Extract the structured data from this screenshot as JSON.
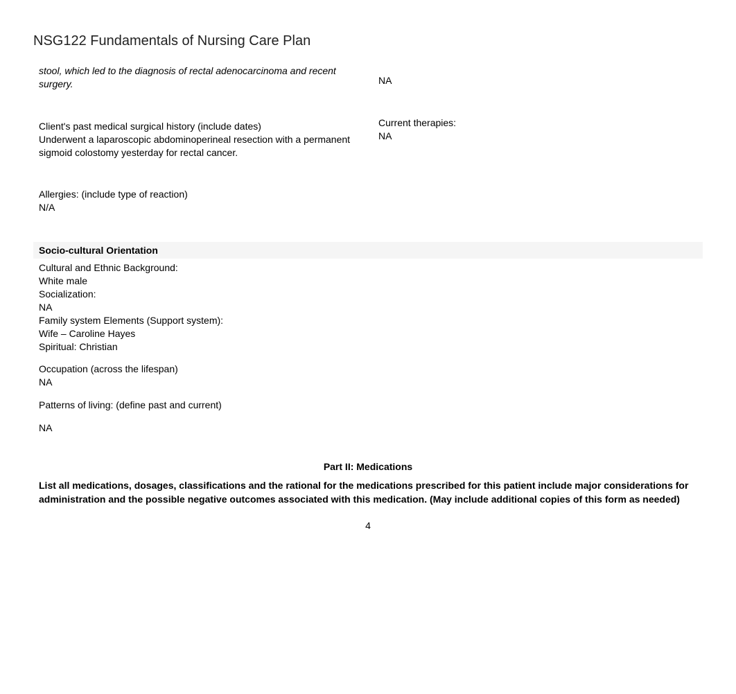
{
  "title": "NSG122 Fundamentals of Nursing Care Plan",
  "left": {
    "chiefComplaintFragment": "stool, which led to the diagnosis of rectal adenocarcinoma and recent surgery.",
    "historyLabel": "Client's past medical surgical history (include dates)",
    "historyValue": "Underwent a laparoscopic abdominoperineal resection with a permanent sigmoid colostomy yesterday for rectal cancer.",
    "allergiesLabel": "Allergies: (include type of reaction)",
    "allergiesValue": "N/A"
  },
  "right": {
    "topValue": "NA",
    "therapiesLabel": "Current therapies:",
    "therapiesValue": "NA"
  },
  "socio": {
    "header": "Socio-cultural Orientation",
    "culturalLabel": "Cultural and Ethnic Background:",
    "culturalValue": "White male",
    "socializationLabel": "Socialization:",
    "socializationValue": "NA",
    "familyLabel": "Family system Elements (Support system):",
    "familyValue": "Wife – Caroline Hayes",
    "spiritual": "Spiritual: Christian",
    "occupationLabel": "Occupation (across the lifespan)",
    "occupationValue": "NA",
    "patternsLabel": "Patterns of living: (define past and current)",
    "patternsValue": "NA"
  },
  "part2": {
    "title": "Part II: Medications",
    "description": "List all medications, dosages, classifications and the rational for the medications prescribed for this patient include major considerations for administration and the possible negative outcomes associated with this medication. (May include additional copies of this form as needed)"
  },
  "pageNumber": "4"
}
